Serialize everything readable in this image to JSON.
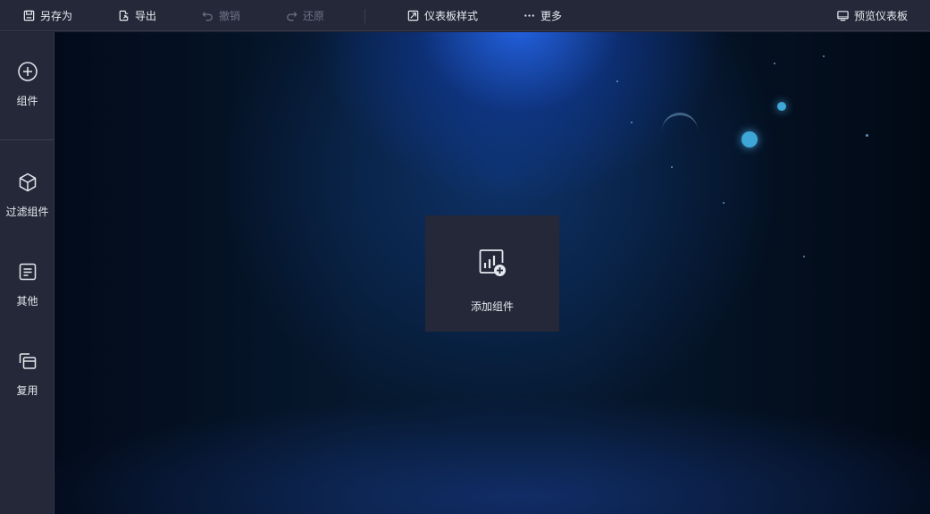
{
  "toolbar": {
    "save_as": "另存为",
    "export": "导出",
    "undo": "撤销",
    "redo": "还原",
    "dashboard_style": "仪表板样式",
    "more": "更多",
    "preview": "预览仪表板"
  },
  "sidebar": {
    "items": [
      {
        "label": "组件",
        "icon": "plus-circle-icon"
      },
      {
        "label": "过滤组件",
        "icon": "cube-icon"
      },
      {
        "label": "其他",
        "icon": "document-icon"
      },
      {
        "label": "复用",
        "icon": "copy-windows-icon"
      }
    ]
  },
  "canvas": {
    "add_component_label": "添加组件"
  },
  "colors": {
    "toolbar_bg": "#242838",
    "card_bg": "#242838",
    "text": "#e6e8ee",
    "disabled_text": "#6d7386"
  }
}
